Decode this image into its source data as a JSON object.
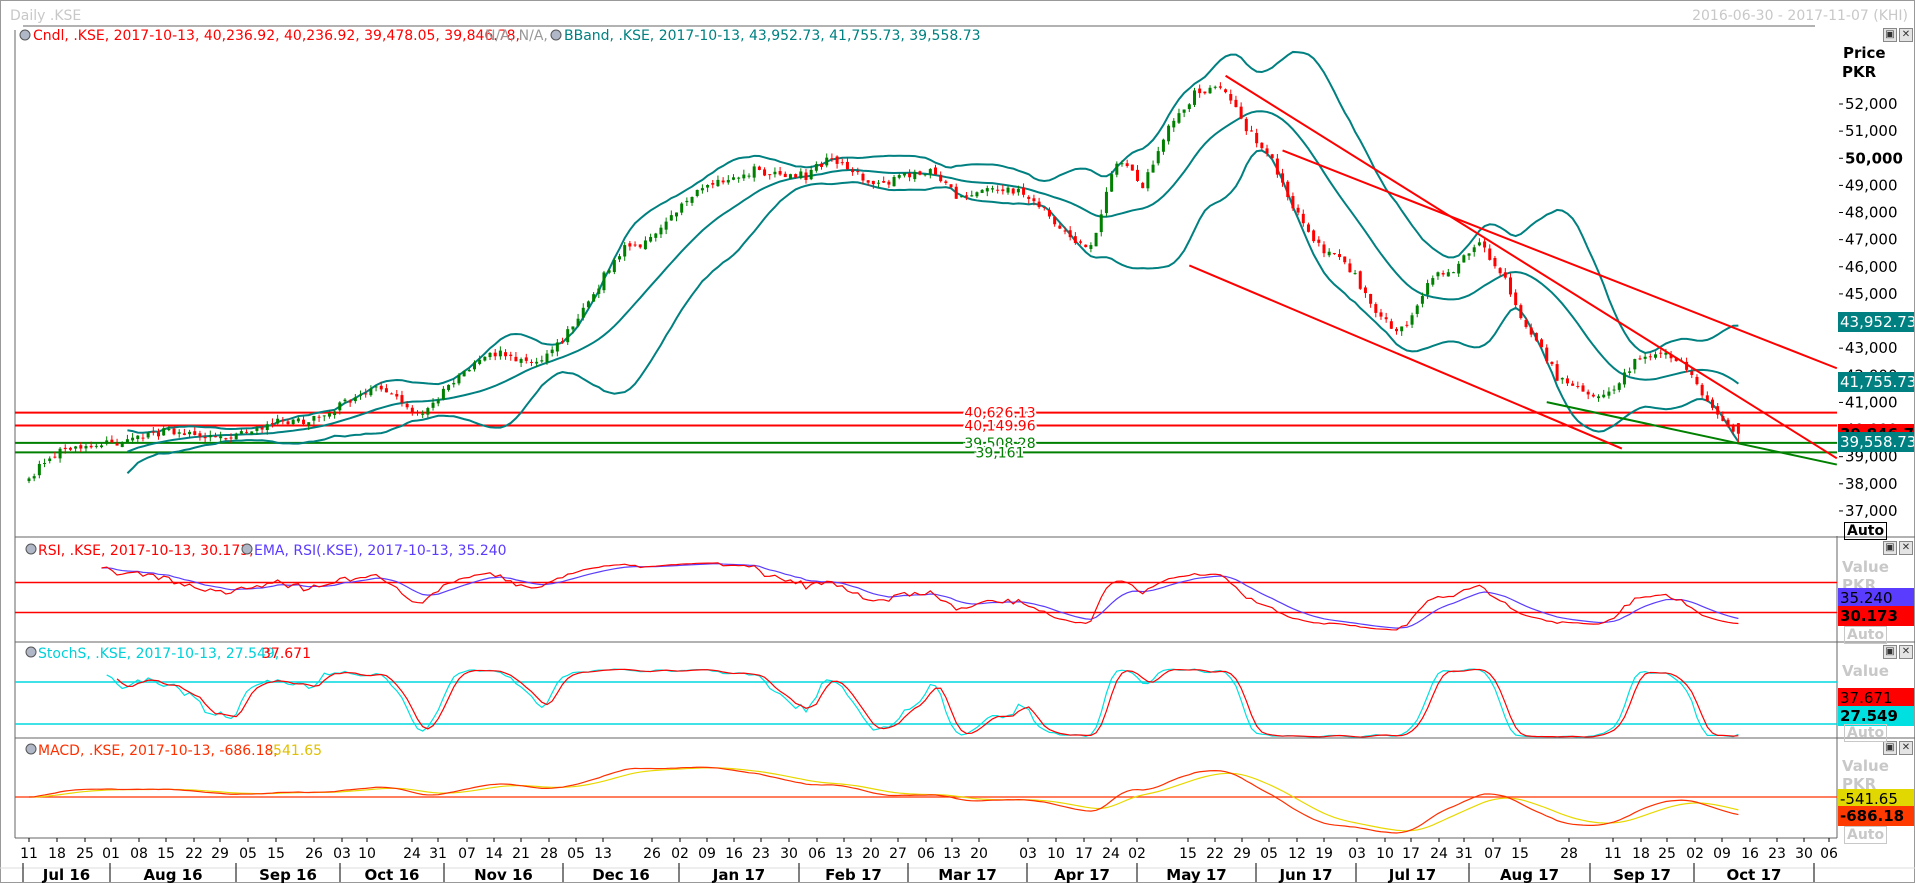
{
  "window": {
    "title": "Daily .KSE",
    "range": "2016-06-30 - 2017-11-07 (KHI)"
  },
  "legend": {
    "cndl": "Cndl, .KSE, 2017-10-13, 40,236.92, 40,236.92, 39,478.05, 39,846.78,",
    "cndl_na": "N/A, N/A,",
    "bband": "BBand, .KSE, 2017-10-13, 43,952.73, 41,755.73, 39,558.73"
  },
  "price_axis": {
    "title": "Price",
    "unit": "PKR",
    "ticks": [
      52000,
      51000,
      50000,
      49000,
      48000,
      47000,
      46000,
      45000,
      44000,
      43000,
      42000,
      41000,
      40000,
      39000,
      38000,
      37000
    ],
    "tick_labels": [
      "52,000",
      "51,000",
      "50,000",
      "49,000",
      "48,000",
      "47,000",
      "46,000",
      "45,000",
      "44,000",
      "43,000",
      "42,000",
      "41,000",
      "40,000",
      "39,000",
      "38,000",
      "37,000"
    ],
    "auto": "Auto"
  },
  "value_boxes": [
    {
      "value": 43952.73,
      "label": "43,952.73",
      "bg": "#008080",
      "fg": "#ffffff"
    },
    {
      "value": 41755.73,
      "label": "41,755.73",
      "bg": "#008080",
      "fg": "#ffffff"
    },
    {
      "value": 39846.78,
      "label": "39,846.78",
      "bg": "#ff0000",
      "fg": "#000000"
    },
    {
      "value": 39558.73,
      "label": "39,558.73",
      "bg": "#008080",
      "fg": "#ffffff"
    }
  ],
  "levels": [
    {
      "value": 40626.13,
      "label": "40,626.13",
      "color": "#ff0000"
    },
    {
      "value": 40149.96,
      "label": "40,149.96",
      "color": "#ff0000"
    },
    {
      "value": 39508.28,
      "label": "39,508.28",
      "color": "#008000"
    },
    {
      "value": 39161,
      "label": "39,161",
      "color": "#008000"
    }
  ],
  "trendlines": [
    {
      "from": [
        46.2,
        53040
      ],
      "to": [
        69.8,
        38940
      ],
      "color": "#ff0000"
    },
    {
      "from": [
        48.4,
        50290
      ],
      "to": [
        69.8,
        42260
      ],
      "color": "#ff0000"
    },
    {
      "from": [
        44.8,
        46050
      ],
      "to": [
        61.5,
        39300
      ],
      "color": "#ff0000"
    },
    {
      "from": [
        58.6,
        41010
      ],
      "to": [
        69.8,
        38710
      ],
      "color": "#008000"
    }
  ],
  "rsi": {
    "legend_rsi": "RSI, .KSE, 2017-10-13, 30.173,",
    "legend_ema": "EMA, RSI(.KSE), 2017-10-13, 35.240",
    "axis_title": "Value",
    "unit": "PKR",
    "ema_value": "35.240",
    "rsi_value": "30.173",
    "auto": "Auto",
    "levels": [
      70,
      30
    ]
  },
  "stoch": {
    "legend_k": "StochS, .KSE, 2017-10-13, 27.549,",
    "legend_d": "37.671",
    "axis_title": "Value",
    "unit": "PKR",
    "d_value": "37.671",
    "k_value": "27.549",
    "auto": "Auto",
    "levels": [
      80,
      20
    ]
  },
  "macd": {
    "legend_macd": "MACD, .KSE, 2017-10-13, -686.18,",
    "legend_signal": "-541.65",
    "axis_title": "Value",
    "unit": "PKR",
    "signal_value": "-541.65",
    "macd_value": "-686.18",
    "auto": "Auto"
  },
  "date_axis": {
    "days": [
      "11",
      "18",
      "25",
      "01",
      "08",
      "15",
      "22",
      "29",
      "05",
      "15",
      "26",
      "03",
      "10",
      "24",
      "31",
      "07",
      "14",
      "21",
      "28",
      "05",
      "13",
      "26",
      "02",
      "09",
      "16",
      "23",
      "30",
      "06",
      "13",
      "20",
      "27",
      "06",
      "13",
      "20",
      "03",
      "10",
      "17",
      "24",
      "02",
      "15",
      "22",
      "29",
      "05",
      "12",
      "19",
      "03",
      "10",
      "17",
      "24",
      "31",
      "07",
      "15",
      "28",
      "11",
      "18",
      "25",
      "02",
      "09",
      "16",
      "23",
      "30",
      "06"
    ],
    "months": [
      "Jul 16",
      "Aug 16",
      "Sep 16",
      "Oct 16",
      "Nov 16",
      "Dec 16",
      "Jan 17",
      "Feb 17",
      "Mar 17",
      "Apr 17",
      "May 17",
      "Jun 17",
      "Jul 17",
      "Aug 17",
      "Sep 17",
      "Oct 17"
    ]
  },
  "chart_data": {
    "type": "candlestick",
    "title": "Daily .KSE",
    "ylabel": "Price PKR",
    "ylim": [
      36000,
      53700
    ],
    "start": "2016-07-11",
    "interval": "week",
    "closes": [
      38200,
      39000,
      39300,
      39600,
      39700,
      39750,
      39800,
      39800,
      39850,
      40000,
      40200,
      40500,
      41000,
      41300,
      41300,
      40600,
      41500,
      42200,
      42700,
      42600,
      42800,
      43800,
      45200,
      46800,
      47100,
      48000,
      48900,
      49200,
      49700,
      49400,
      49200,
      50000,
      49500,
      49100,
      49300,
      49400,
      48600,
      48900,
      48700,
      48200,
      47300,
      46800,
      49800,
      48900,
      51200,
      52500,
      52600,
      51000,
      50000,
      48000,
      46500,
      45800,
      44300,
      43800,
      45400,
      45800,
      46900,
      45600,
      43500,
      41800,
      41400,
      41400,
      42600,
      42800,
      42200,
      40800,
      39846.78
    ],
    "last_candle": {
      "date": "2017-10-13",
      "open": 40236.92,
      "high": 40236.92,
      "low": 39478.05,
      "close": 39846.78
    },
    "bollinger_last": {
      "upper": 43952.73,
      "middle": 41755.73,
      "lower": 39558.73
    }
  }
}
